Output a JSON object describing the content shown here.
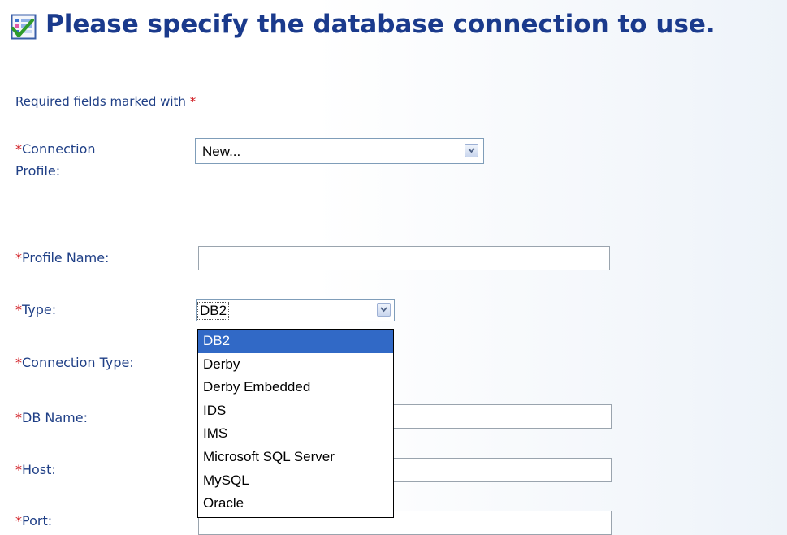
{
  "header": {
    "title": "Please specify the database connection to use."
  },
  "required_note": {
    "text": "Required fields marked with",
    "star": "*"
  },
  "form": {
    "connection_profile": {
      "label_line1": "Connection",
      "label_line2": "Profile:",
      "value": "New..."
    },
    "profile_name": {
      "label": "Profile Name:",
      "value": ""
    },
    "type": {
      "label": "Type:",
      "value": "DB2"
    },
    "connection_type": {
      "label": "Connection Type:"
    },
    "db_name": {
      "label": "DB Name:",
      "value": ""
    },
    "host": {
      "label": "Host:",
      "value": ""
    },
    "port": {
      "label": "Port:",
      "value": ""
    }
  },
  "type_options": [
    "DB2",
    "Derby",
    "Derby Embedded",
    "IDS",
    "IMS",
    "Microsoft SQL Server",
    "MySQL",
    "Oracle"
  ],
  "colors": {
    "title": "#1a3a8c",
    "label": "#1f3f86",
    "required": "#d0161c",
    "selection": "#3169c6"
  }
}
